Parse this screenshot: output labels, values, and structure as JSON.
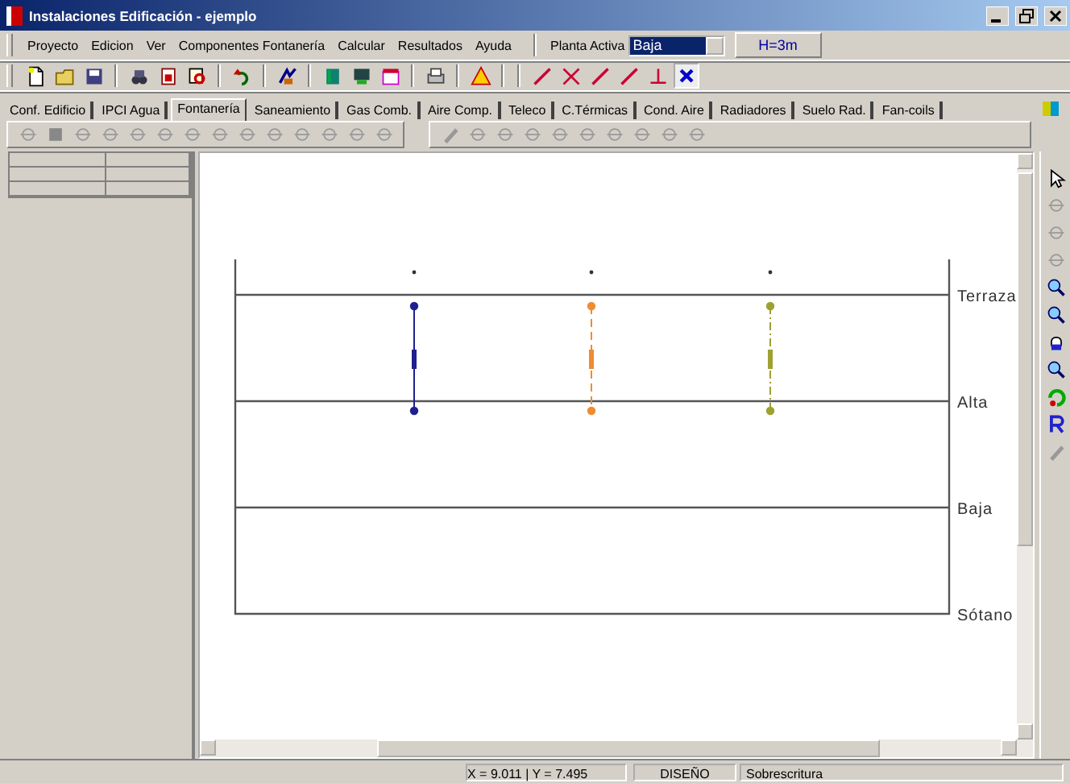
{
  "window": {
    "title": "Instalaciones Edificación - ejemplo"
  },
  "menu": [
    "Proyecto",
    "Edicion",
    "Ver",
    "Componentes Fontanería",
    "Calcular",
    "Resultados",
    "Ayuda"
  ],
  "planta_activa": {
    "label": "Planta Activa",
    "value": "Baja",
    "height": "H=3m"
  },
  "tabs": [
    {
      "label": "Conf. Edificio",
      "selected": false
    },
    {
      "label": "IPCI Agua",
      "selected": false
    },
    {
      "label": "Fontanería",
      "selected": true
    },
    {
      "label": "Saneamiento",
      "selected": false
    },
    {
      "label": "Gas Comb.",
      "selected": false
    },
    {
      "label": "Aire Comp.",
      "selected": false
    },
    {
      "label": "Teleco",
      "selected": false
    },
    {
      "label": "C.Térmicas",
      "selected": false
    },
    {
      "label": "Cond. Aire",
      "selected": false
    },
    {
      "label": "Radiadores",
      "selected": false
    },
    {
      "label": "Suelo Rad.",
      "selected": false
    },
    {
      "label": "Fan-coils",
      "selected": false
    }
  ],
  "floors": [
    "Terraza",
    "Alta",
    "Baja",
    "Sótano"
  ],
  "risers": [
    {
      "kind": "solid",
      "color": "#1f1f8f"
    },
    {
      "kind": "dashed",
      "color": "#f08c30"
    },
    {
      "kind": "dashdot",
      "color": "#a0a030"
    }
  ],
  "status_bar": {
    "coordinates": "X = 9.011 | Y = 7.495",
    "mode": "DISEÑO",
    "overwrite": "Sobrescritura"
  }
}
